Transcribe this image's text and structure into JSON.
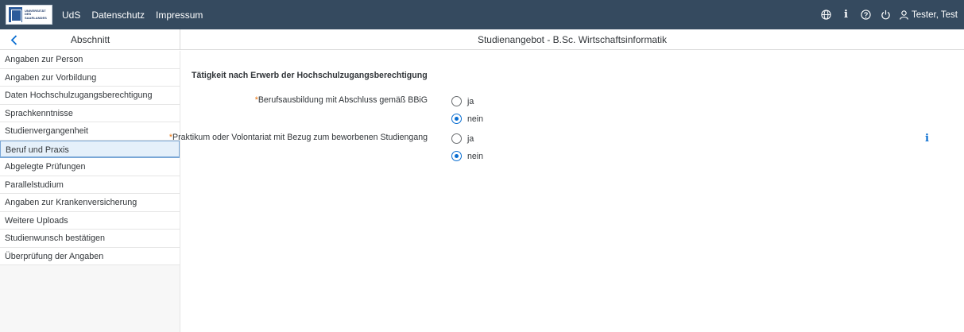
{
  "header": {
    "logo": {
      "line1": "UNIVERSITÄT",
      "line2": "DES",
      "line3": "SAARLANDES"
    },
    "links": [
      "UdS",
      "Datenschutz",
      "Impressum"
    ],
    "icons": [
      "globe-icon",
      "info-icon",
      "help-icon",
      "power-icon"
    ],
    "user_name": "Tester, Test",
    "background": "#354a5f"
  },
  "subheader": {
    "left_title": "Abschnitt",
    "title": "Studienangebot - B.Sc. Wirtschaftsinformatik"
  },
  "sidebar": {
    "items": [
      {
        "label": "Angaben zur Person"
      },
      {
        "label": "Angaben zur Vorbildung"
      },
      {
        "label": "Daten Hochschulzugangsberechtigung"
      },
      {
        "label": "Sprachkenntnisse"
      },
      {
        "label": "Studienvergangenheit"
      },
      {
        "label": "Beruf und Praxis",
        "selected": true
      },
      {
        "label": "Abgelegte Prüfungen"
      },
      {
        "label": "Parallelstudium"
      },
      {
        "label": "Angaben zur Krankenversicherung"
      },
      {
        "label": "Weitere Uploads"
      },
      {
        "label": "Studienwunsch bestätigen"
      },
      {
        "label": "Überprüfung der Angaben"
      }
    ]
  },
  "main": {
    "section_title": "Tätigkeit nach Erwerb der Hochschulzugangsberechtigung",
    "fields": [
      {
        "required_mark": "*",
        "label": "Berufsausbildung mit Abschluss gemäß BBiG",
        "options": [
          {
            "label": "ja",
            "checked": false
          },
          {
            "label": "nein",
            "checked": true
          }
        ]
      },
      {
        "required_mark": "*",
        "label": "Praktikum oder Volontariat mit Bezug zum beworbenen Studiengang",
        "options": [
          {
            "label": "ja",
            "checked": false
          },
          {
            "label": "nein",
            "checked": true
          }
        ]
      }
    ],
    "info_glyph": "i"
  },
  "colors": {
    "accent": "#0a6ed1",
    "required": "#e9730c",
    "selected_bg": "#e5f0fa"
  }
}
